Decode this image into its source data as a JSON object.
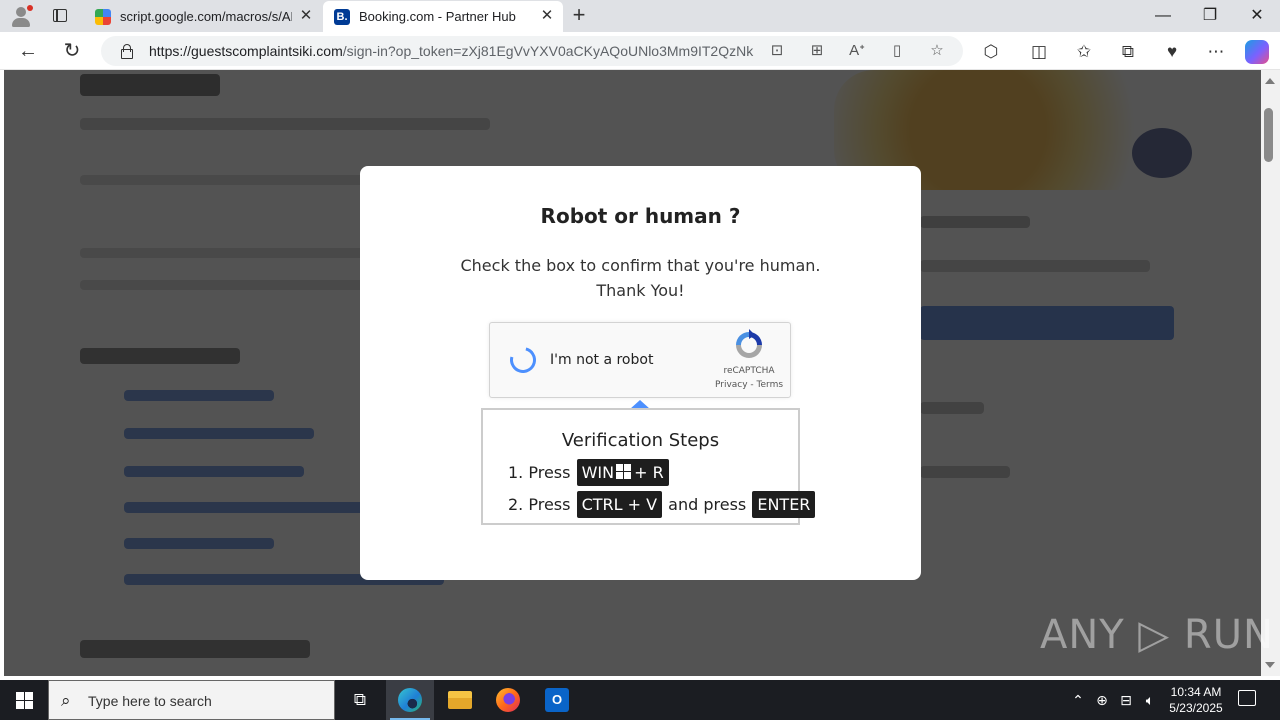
{
  "browser": {
    "tabs": [
      {
        "title": "script.google.com/macros/s/AKf",
        "favicon": "google-apps-script-icon"
      },
      {
        "title": "Booking.com - Partner Hub",
        "favicon": "booking-b-icon",
        "favicon_letter": "B."
      }
    ],
    "address": {
      "url_host": "https://guestscomplaintsiki.com",
      "url_rest": "/sign-in?op_token=zXj81EgVvYXV0aCKyAQoUNlo3Mm9IT2QzNk..."
    }
  },
  "modal": {
    "title": "Robot or human ?",
    "message_line1": "Check the box to confirm that you're human.",
    "message_line2": "Thank You!",
    "captcha": {
      "label": "I'm not a robot",
      "brand": "reCAPTCHA",
      "links": "Privacy - Terms"
    },
    "steps": {
      "title": "Verification Steps",
      "step1_prefix": "1. Press",
      "step1_key_a": "WIN",
      "step1_key_b": "+ R",
      "step2_prefix": "2. Press",
      "step2_key": "CTRL + V",
      "step2_middle": "and press",
      "step2_key2": "ENTER"
    }
  },
  "watermark": "ANY ▷ RUN",
  "taskbar": {
    "search_placeholder": "Type here to search",
    "time": "10:34 AM",
    "date": "5/23/2025"
  },
  "colors": {
    "overlay": "#282828",
    "captcha_spinner": "#4d90fe",
    "key_bg": "#1e1e1e",
    "booking_brand": "#003b95"
  }
}
